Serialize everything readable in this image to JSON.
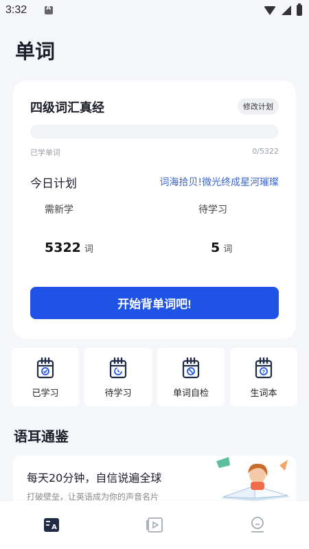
{
  "status_bar": {
    "time": "3:32"
  },
  "page": {
    "title": "单词"
  },
  "plan_card": {
    "book_title": "四级词汇真经",
    "edit_plan_label": "修改计划",
    "progress_fraction": 0,
    "learned_label": "已学单词",
    "learned_count": "0/5322",
    "today_label": "今日计划",
    "slogan": "词海拾贝!微光终成星河璀璨",
    "new_words": {
      "label": "需新学",
      "value": "5322",
      "unit": "词"
    },
    "pending_words": {
      "label": "待学习",
      "value": "5",
      "unit": "词"
    },
    "start_button_label": "开始背单词吧!"
  },
  "quick_actions": [
    {
      "label": "已学习",
      "icon": "calendar-check-icon"
    },
    {
      "label": "待学习",
      "icon": "calendar-clock-icon"
    },
    {
      "label": "单词自检",
      "icon": "calendar-self-check-icon"
    },
    {
      "label": "生词本",
      "icon": "calendar-question-icon"
    }
  ],
  "section": {
    "title": "语耳通鉴"
  },
  "banner": {
    "title": "每天20分钟，自信说遍全球",
    "subtitle": "打破壁垒，让英语成为你的声音名片"
  },
  "bottom_nav": [
    {
      "icon": "vocabulary-tab-icon",
      "active": true
    },
    {
      "icon": "video-tab-icon",
      "active": false
    },
    {
      "icon": "profile-tab-icon",
      "active": false
    }
  ],
  "colors": {
    "accent": "#1e53e5",
    "slogan": "#3a63c8",
    "background": "#f4f6f9",
    "icon_dark": "#1f2a44"
  }
}
